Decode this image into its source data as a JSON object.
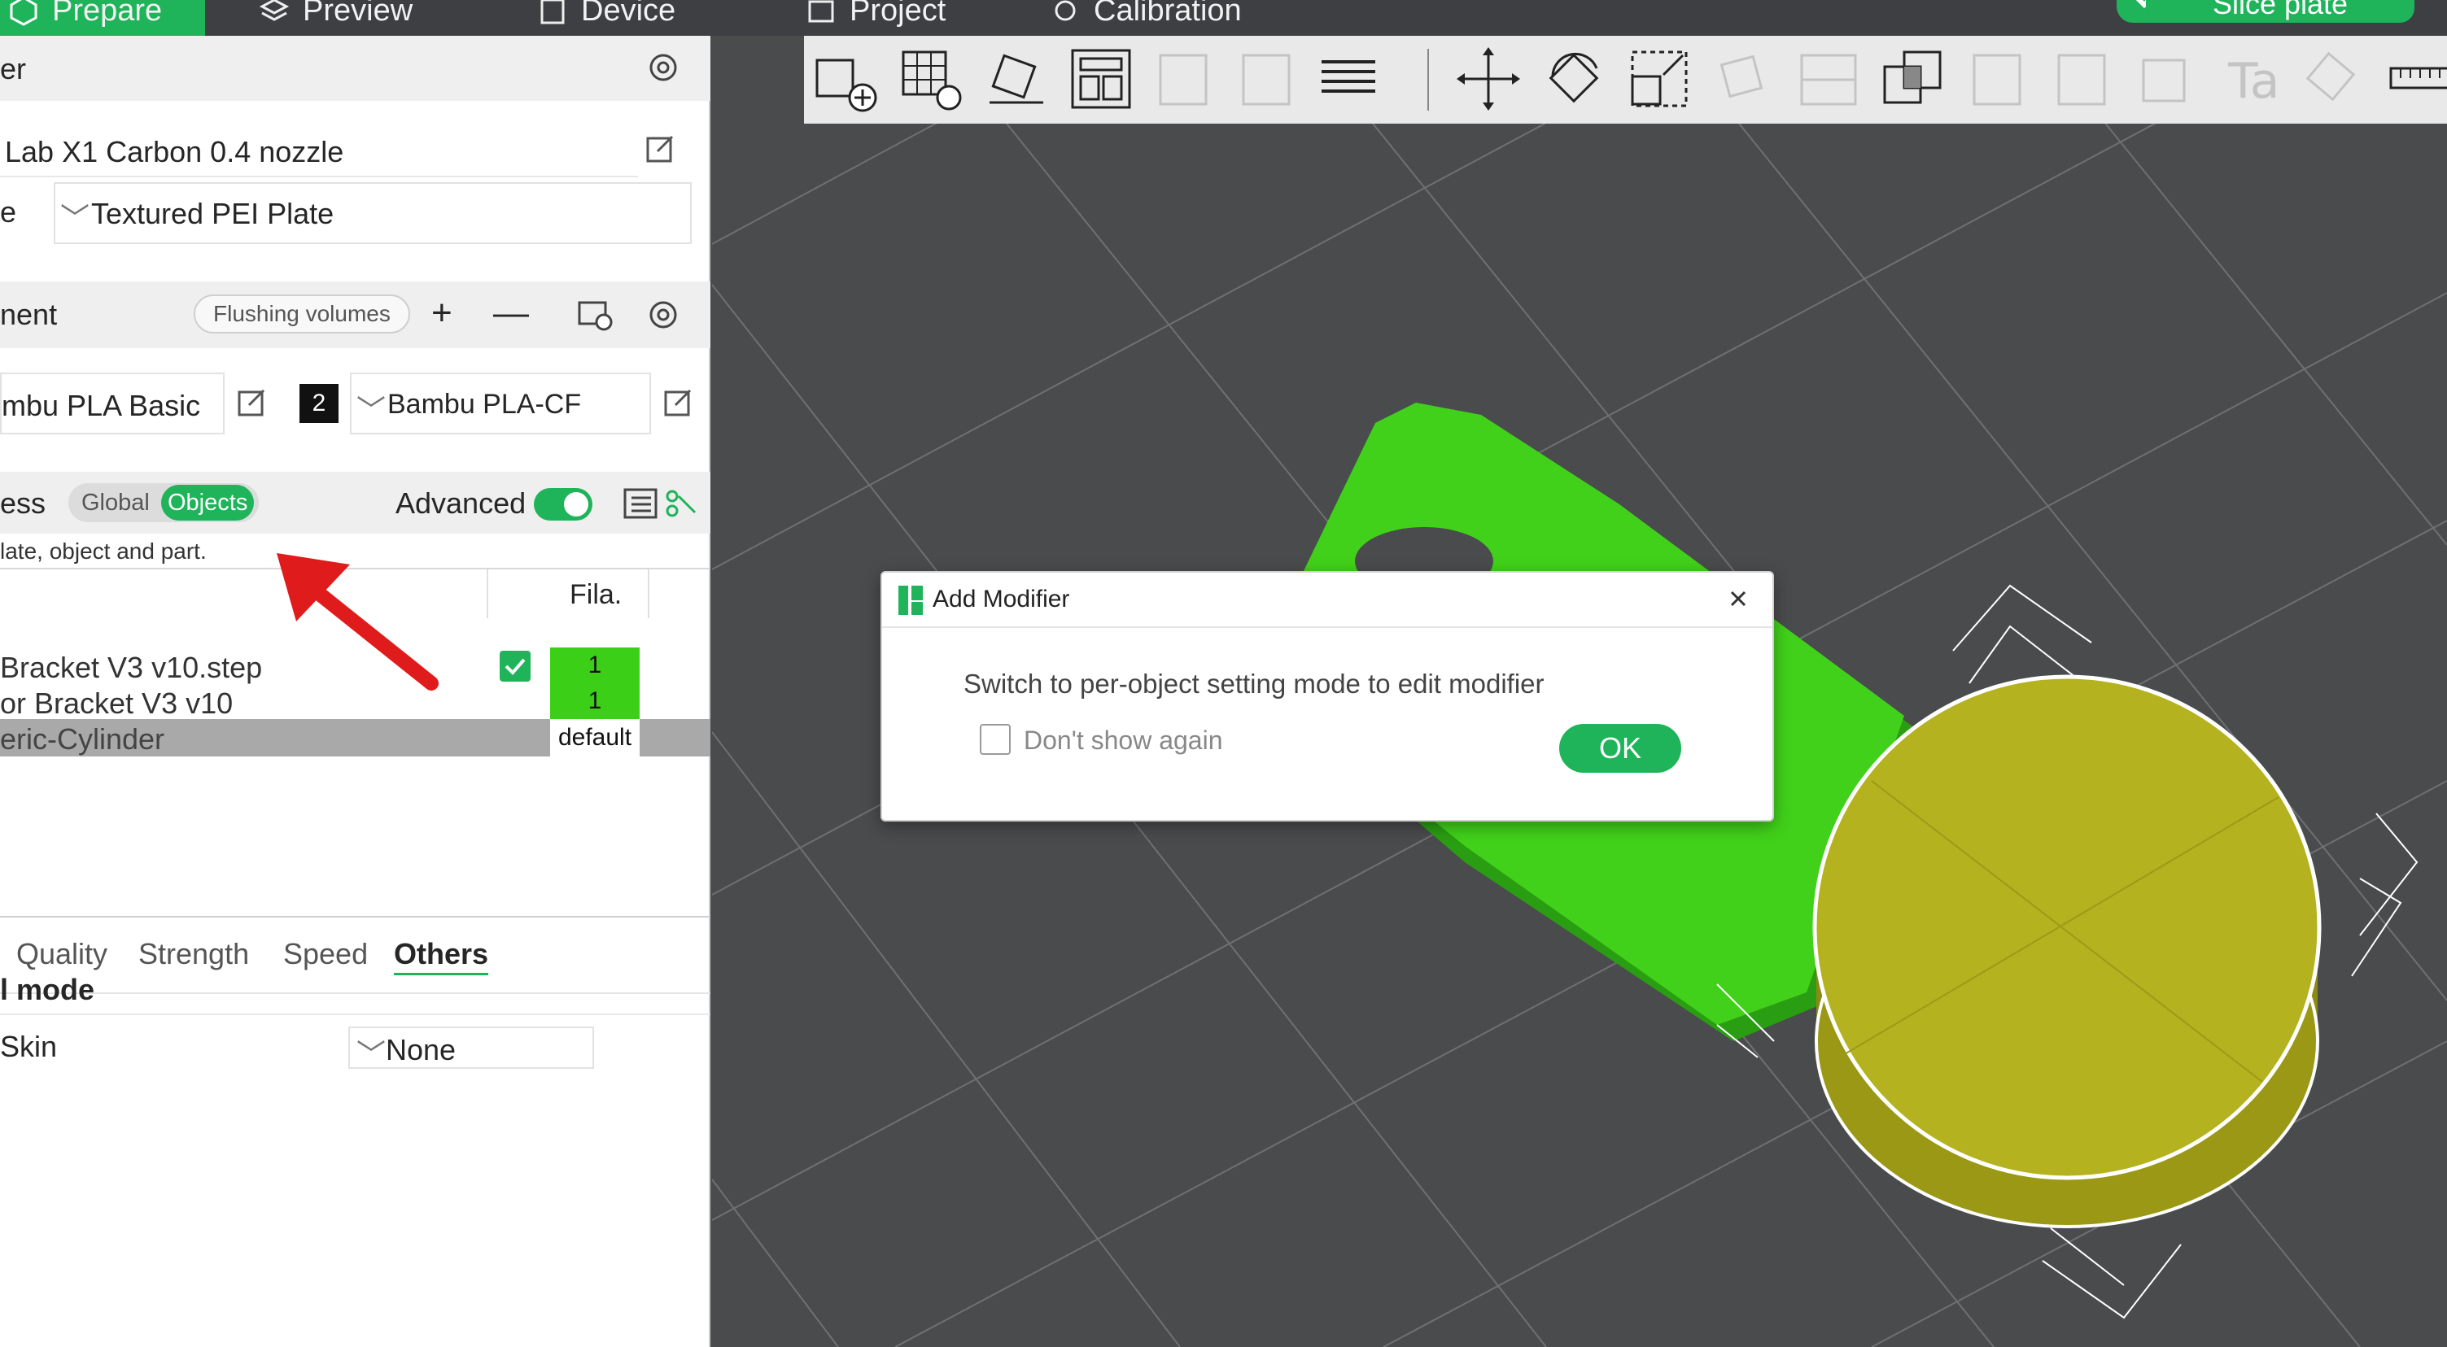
{
  "topbar": {
    "tabs": [
      "Prepare",
      "Preview",
      "Device",
      "Project",
      "Calibration"
    ],
    "slice_label": "Slice plate"
  },
  "printer": {
    "section_label": "er",
    "printer_name": "Lab X1 Carbon 0.4 nozzle",
    "plate_label": "e",
    "plate_value": "Textured PEI Plate"
  },
  "filament": {
    "section_label": "nent",
    "flushing_label": "Flushing volumes",
    "slot1_value": "mbu PLA Basic",
    "slot2_number": "2",
    "slot2_value": "Bambu PLA-CF"
  },
  "process": {
    "section_label": "ess",
    "global_label": "Global",
    "objects_label": "Objects",
    "advanced_label": "Advanced",
    "hint": "late, object and part."
  },
  "object_table": {
    "fila_header": "Fila.",
    "rows": [
      {
        "name": "Bracket V3 v10.step",
        "fila": "1"
      },
      {
        "name": "or Bracket V3 v10",
        "fila": "1"
      },
      {
        "name": "eric-Cylinder",
        "fila": "default"
      }
    ]
  },
  "settings_tabs": {
    "quality": "Quality",
    "strength": "Strength",
    "speed": "Speed",
    "others": "Others"
  },
  "others": {
    "mode_heading": "l mode",
    "skin_label": "Skin",
    "skin_value": "None"
  },
  "dialog": {
    "title": "Add Modifier",
    "message": "Switch to per-object setting mode to edit modifier",
    "dont_show": "Don't show again",
    "ok": "OK"
  },
  "colors": {
    "accent": "#1fb35a",
    "object_green": "#3bcf17",
    "modifier_yellow": "#b4b21f",
    "arrow_red": "#e01b1b",
    "viewport_bg": "#4a4b4d"
  }
}
